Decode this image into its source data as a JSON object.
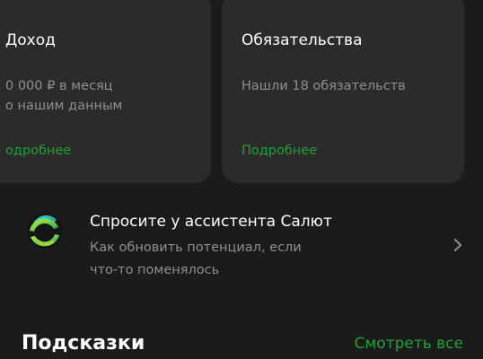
{
  "cards": {
    "income": {
      "title": "Доход",
      "line1": "0 000 ₽ в месяц",
      "line2": "о нашим данным",
      "link": "одробнее"
    },
    "obligations": {
      "title": "Обязательства",
      "line1": "Нашли 18 обязательств",
      "link": "Подробнее"
    }
  },
  "assistant": {
    "icon": "salute-logo-icon",
    "title": "Спросите у ассистента Салют",
    "desc_line1": "Как обновить потенциал, если",
    "desc_line2": "что-то поменялось",
    "chevron": "chevron-right-icon"
  },
  "hints": {
    "title": "Подсказки",
    "see_all": "Смотреть все"
  },
  "colors": {
    "background": "#1b1b1b",
    "card": "#2b2b2b",
    "accent_green": "#21a038",
    "secondary_text": "#8f8f8f"
  }
}
